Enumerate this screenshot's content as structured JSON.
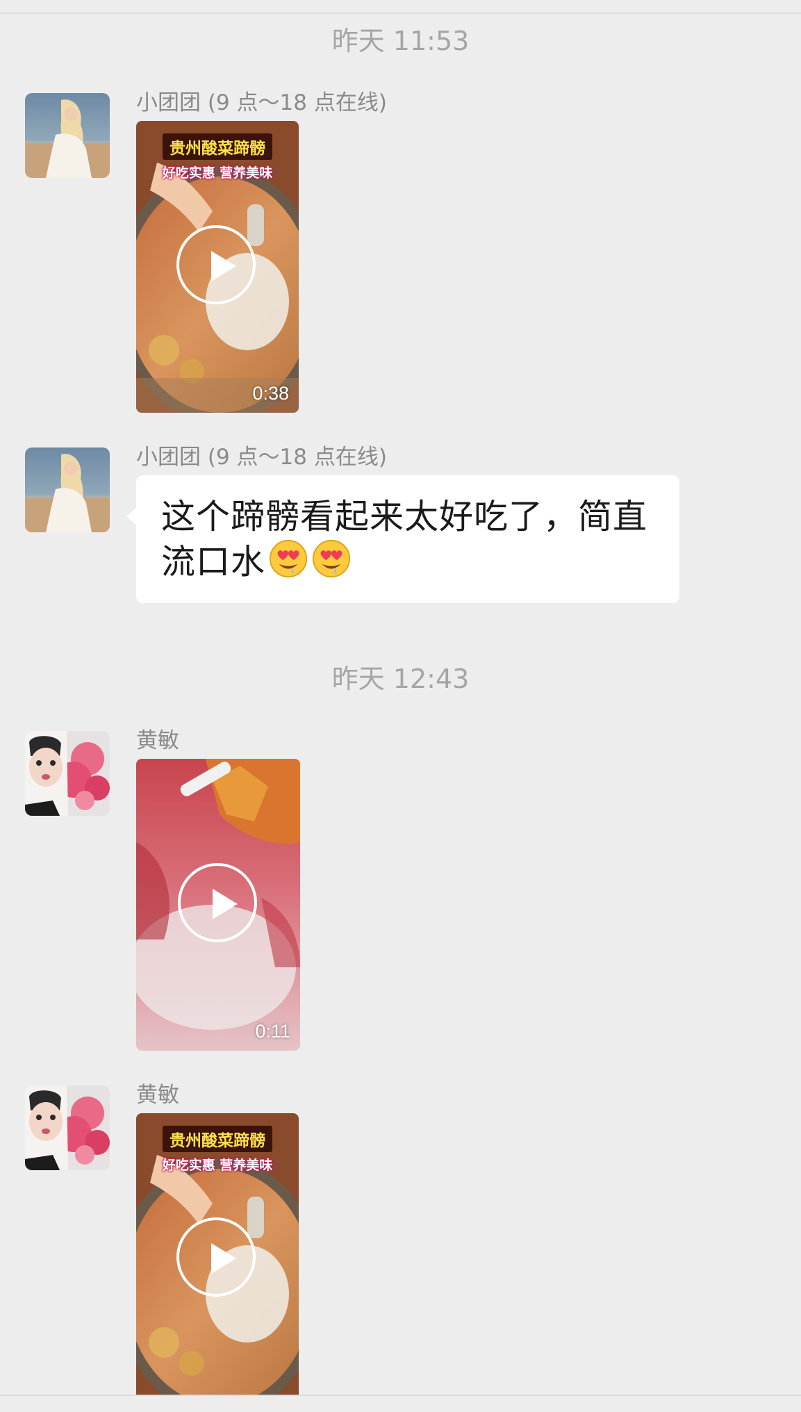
{
  "timestamps": [
    "昨天 11:53",
    "昨天 12:43"
  ],
  "messages": [
    {
      "sender": "小团团 (9 点～18 点在线)",
      "type": "video",
      "duration": "0:38",
      "banner_title": "贵州酸菜蹄髈",
      "banner_subtitle": "好吃实惠  营养美味"
    },
    {
      "sender": "小团团 (9 点～18 点在线)",
      "type": "text",
      "text_line1": "这个蹄髈看起来太好吃了，简直",
      "text_line2": "流口水",
      "emojis": [
        "heart-eyes-drool-emoji",
        "heart-eyes-drool-emoji"
      ]
    },
    {
      "sender": "黄敏",
      "type": "video",
      "duration": "0:11"
    },
    {
      "sender": "黄敏",
      "type": "video",
      "banner_title": "贵州酸菜蹄髈",
      "banner_subtitle": "好吃实惠  营养美味"
    }
  ],
  "colors": {
    "background": "#ededed",
    "bubble": "#ffffff",
    "timestamp_text": "#a5a5a5",
    "sender_text": "#8a8a8a",
    "message_text": "#1a1a1a"
  },
  "icons": [
    "play-icon",
    "heart-eyes-drool-emoji"
  ]
}
